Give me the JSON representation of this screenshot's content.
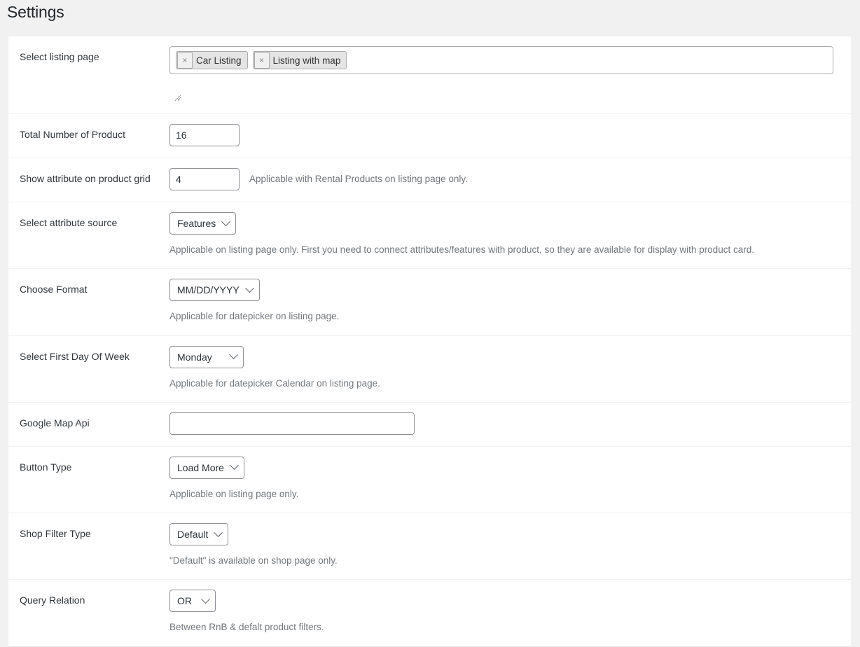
{
  "page": {
    "title": "Settings"
  },
  "rows": {
    "listing_page": {
      "label": "Select listing page",
      "tokens": [
        {
          "remove": "×",
          "label": "Car Listing"
        },
        {
          "remove": "×",
          "label": "Listing with map"
        }
      ]
    },
    "total_products": {
      "label": "Total Number of Product",
      "value": "16"
    },
    "attribute_grid": {
      "label": "Show attribute on product grid",
      "value": "4",
      "desc": "Applicable with Rental Products on listing page only."
    },
    "attribute_source": {
      "label": "Select attribute source",
      "value": "Features",
      "desc": "Applicable on listing page only. First you need to connect attributes/features with product, so they are available for display with product card."
    },
    "choose_format": {
      "label": "Choose Format",
      "value": "MM/DD/YYYY",
      "desc": "Applicable for datepicker on listing page."
    },
    "first_day": {
      "label": "Select First Day Of Week",
      "value": "Monday",
      "desc": "Applicable for datepicker Calendar on listing page."
    },
    "google_map_api": {
      "label": "Google Map Api",
      "value": "",
      "placeholder": ""
    },
    "button_type": {
      "label": "Button Type",
      "value": "Load More",
      "desc": "Applicable on listing page only."
    },
    "shop_filter_type": {
      "label": "Shop Filter Type",
      "value": "Default",
      "desc": "\"Default\" is available on shop page only."
    },
    "query_relation": {
      "label": "Query Relation",
      "value": "OR",
      "desc": "Between RnB & defalt product filters."
    }
  },
  "icons": {
    "chevron": "chevron-down-icon",
    "remove": "remove-token-icon",
    "resize": "resize-grip-icon"
  },
  "colors": {
    "page_bg": "#f1f1f1",
    "panel_bg": "#ffffff",
    "title": "#23282d",
    "label": "#32373c",
    "desc": "#72777c",
    "border": "#8c8f94",
    "row_divider": "#f0f0f0",
    "token_bg": "#e4e4e4"
  }
}
